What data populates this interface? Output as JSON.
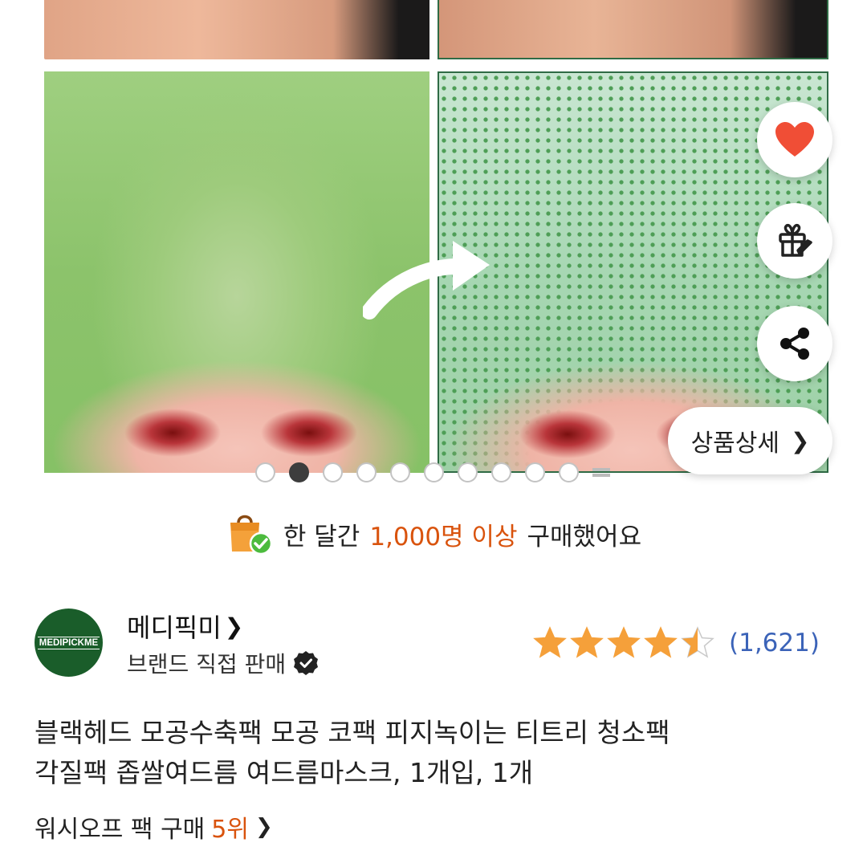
{
  "gallery": {
    "current_index": 2,
    "total_dots": 11,
    "detail_button_label": "상품상세",
    "side_actions": [
      "heart-icon",
      "gift-icon",
      "share-icon"
    ]
  },
  "purchase_banner": {
    "prefix": "한 달간",
    "highlight": "1,000명 이상",
    "suffix": "구매했어요"
  },
  "seller": {
    "logo_text": "MEDIPICKME",
    "name": "메디픽미",
    "subtitle": "브랜드 직접 판매"
  },
  "rating": {
    "stars": 4.5,
    "max_stars": 5,
    "review_count": "(1,621)"
  },
  "product": {
    "title_line1": "블랙헤드 모공수축팩 모공 코팩 피지녹이는 티트리 청소팩",
    "title_line2": "각질팩 좁쌀여드름 여드름마스크, 1개입, 1개"
  },
  "ranking": {
    "label": "워시오프 팩 구매",
    "rank": "5위"
  },
  "colors": {
    "accent_orange": "#d9530d",
    "review_blue": "#3b63b8",
    "heart_red": "#f04e36",
    "star_orange": "#f5a03a"
  }
}
